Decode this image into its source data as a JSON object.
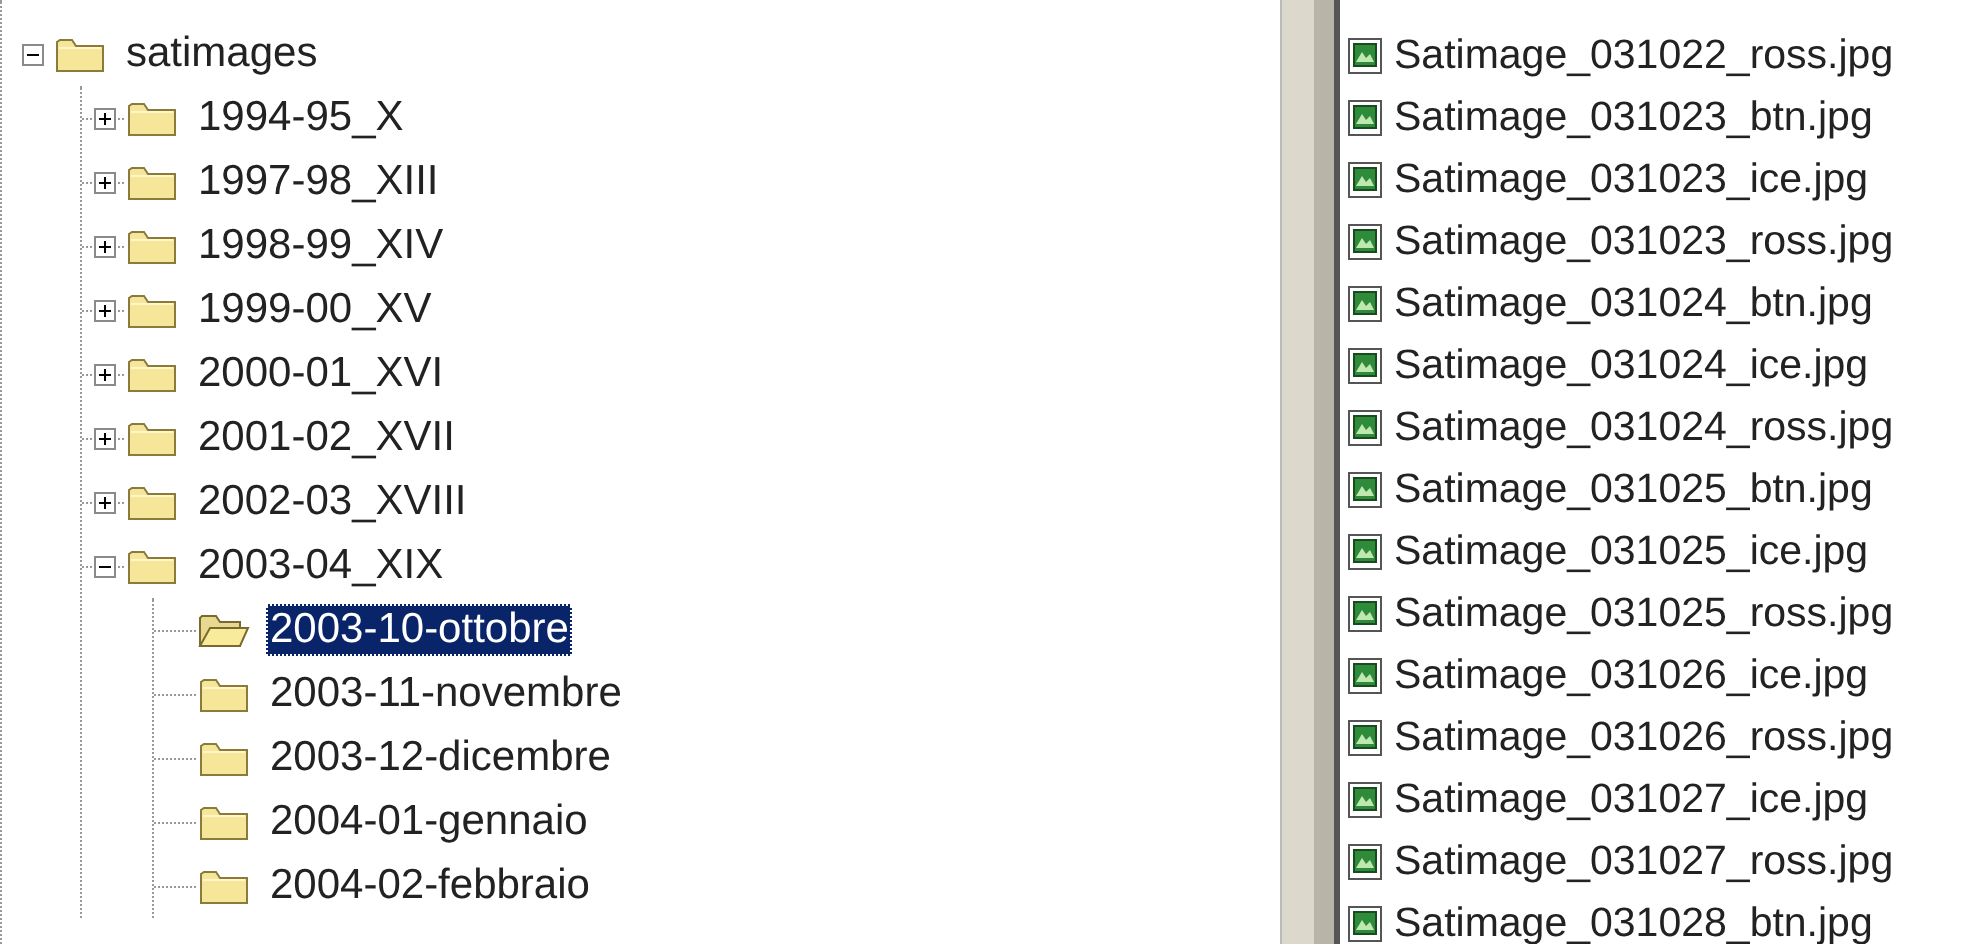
{
  "folder_tree": {
    "label": "satimages",
    "expanded": true,
    "selected": false,
    "children": [
      {
        "label": "1994-95_X",
        "expanded": false,
        "selected": false
      },
      {
        "label": "1997-98_XIII",
        "expanded": false,
        "selected": false
      },
      {
        "label": "1998-99_XIV",
        "expanded": false,
        "selected": false
      },
      {
        "label": "1999-00_XV",
        "expanded": false,
        "selected": false
      },
      {
        "label": "2000-01_XVI",
        "expanded": false,
        "selected": false
      },
      {
        "label": "2001-02_XVII",
        "expanded": false,
        "selected": false
      },
      {
        "label": "2002-03_XVIII",
        "expanded": false,
        "selected": false
      },
      {
        "label": "2003-04_XIX",
        "expanded": true,
        "selected": false,
        "children": [
          {
            "label": "2003-10-ottobre",
            "selected": true
          },
          {
            "label": "2003-11-novembre",
            "selected": false
          },
          {
            "label": "2003-12-dicembre",
            "selected": false
          },
          {
            "label": "2004-01-gennaio",
            "selected": false
          },
          {
            "label": "2004-02-febbraio",
            "selected": false
          }
        ]
      }
    ]
  },
  "file_list": [
    {
      "name": "Satimage_031022_ross.jpg"
    },
    {
      "name": "Satimage_031023_btn.jpg"
    },
    {
      "name": "Satimage_031023_ice.jpg"
    },
    {
      "name": "Satimage_031023_ross.jpg"
    },
    {
      "name": "Satimage_031024_btn.jpg"
    },
    {
      "name": "Satimage_031024_ice.jpg"
    },
    {
      "name": "Satimage_031024_ross.jpg"
    },
    {
      "name": "Satimage_031025_btn.jpg"
    },
    {
      "name": "Satimage_031025_ice.jpg"
    },
    {
      "name": "Satimage_031025_ross.jpg"
    },
    {
      "name": "Satimage_031026_ice.jpg"
    },
    {
      "name": "Satimage_031026_ross.jpg"
    },
    {
      "name": "Satimage_031027_ice.jpg"
    },
    {
      "name": "Satimage_031027_ross.jpg"
    },
    {
      "name": "Satimage_031028_btn.jpg"
    }
  ]
}
